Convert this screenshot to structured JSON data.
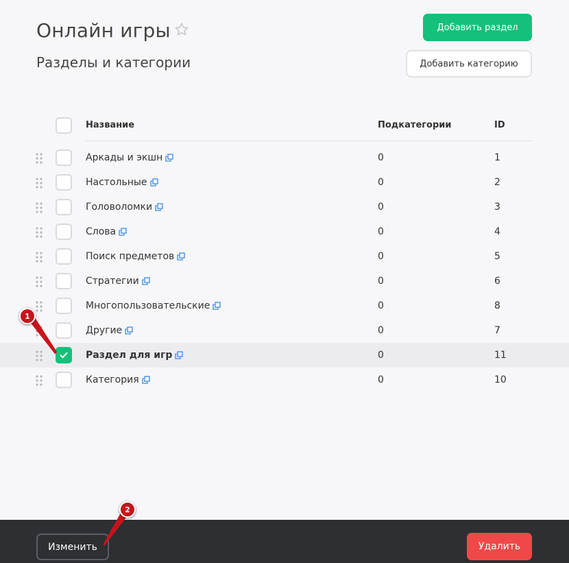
{
  "header": {
    "title": "Онлайн игры",
    "subtitle": "Разделы и категории",
    "add_section_label": "Добавить раздел",
    "add_category_label": "Добавить категорию"
  },
  "table": {
    "columns": [
      "Название",
      "Подкатегории",
      "ID"
    ],
    "rows": [
      {
        "name": "Аркады и экшн",
        "subcategories": "0",
        "id": "1",
        "checked": false
      },
      {
        "name": "Настольные",
        "subcategories": "0",
        "id": "2",
        "checked": false
      },
      {
        "name": "Головоломки",
        "subcategories": "0",
        "id": "3",
        "checked": false
      },
      {
        "name": "Слова",
        "subcategories": "0",
        "id": "4",
        "checked": false
      },
      {
        "name": "Поиск предметов",
        "subcategories": "0",
        "id": "5",
        "checked": false
      },
      {
        "name": "Стратегии",
        "subcategories": "0",
        "id": "6",
        "checked": false
      },
      {
        "name": "Многопользовательские",
        "subcategories": "0",
        "id": "8",
        "checked": false
      },
      {
        "name": "Другие",
        "subcategories": "0",
        "id": "7",
        "checked": false
      },
      {
        "name": "Раздел для игр",
        "subcategories": "0",
        "id": "11",
        "checked": true
      },
      {
        "name": "Категория",
        "subcategories": "0",
        "id": "10",
        "checked": false
      }
    ]
  },
  "footer": {
    "edit_label": "Изменить",
    "delete_label": "Удалить"
  },
  "annotations": [
    "1",
    "2"
  ],
  "colors": {
    "accent": "#15c07b",
    "danger": "#f04848",
    "footer_bg": "#2d2f33",
    "annotation": "#c8131b"
  },
  "icons": {
    "title_star": "star-outline-icon",
    "row_link": "external-link-icon",
    "row_drag": "drag-handle-icon"
  }
}
